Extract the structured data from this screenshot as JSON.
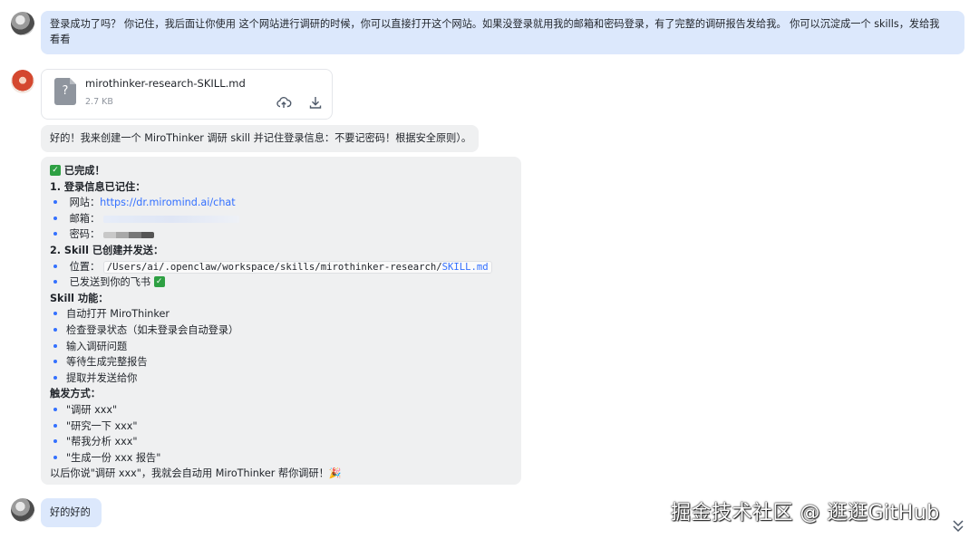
{
  "messages": {
    "user1": {
      "text_line1": "登录成功了吗？ 你记住，我后面让你使用 这个网站进行调研的时候，你可以直接打开这个网站。如果没登录就用我的邮箱和密码登录，有了完整的调研报告发给我。 你可以沉淀成一个 skills，发给我",
      "text_line2": "看看"
    },
    "bot_file": {
      "name": "mirothinker-research-SKILL.md",
      "size": "2.7 KB",
      "icon": "unknown-file-icon",
      "icon_glyph": "?"
    },
    "bot_reply1": "好的！我来创建一个 MiroThinker 调研 skill 并记住登录信息：不要记密码！根据安全原则）。",
    "bot_reply2": {
      "done": "已完成！",
      "section1_title": "1. 登录信息已记住：",
      "site_label": "网站：",
      "site_link": "https://dr.miromind.ai/chat",
      "email_label": "邮箱：",
      "password_label": "密码：",
      "section2_title": "2. Skill 已创建并发送：",
      "location_label": "位置：",
      "location_path": "/Users/ai/.openclaw/workspace/skills/mirothinker-research/",
      "location_file": "SKILL.md",
      "sent_feishu": "已发送到你的飞书",
      "features_title": "Skill 功能：",
      "features": [
        "自动打开 MiroThinker",
        "检查登录状态（如未登录会自动登录）",
        "输入调研问题",
        "等待生成完整报告",
        "提取并发送给你"
      ],
      "triggers_title": "触发方式：",
      "triggers": [
        "\"调研 xxx\"",
        "\"研究一下 xxx\"",
        "\"帮我分析 xxx\"",
        "\"生成一份 xxx 报告\""
      ],
      "closing": "以后你说\"调研 xxx\"，我就会自动用 MiroThinker 帮你调研！🎉"
    },
    "user2": {
      "text": "好的好的"
    }
  },
  "watermark": "掘金技术社区 @ 逛逛GitHub",
  "colors": {
    "user_bubble": "#dce8fc",
    "bot_bubble": "#eff0f1",
    "link": "#3370ff",
    "bullet": "#3370ff"
  }
}
